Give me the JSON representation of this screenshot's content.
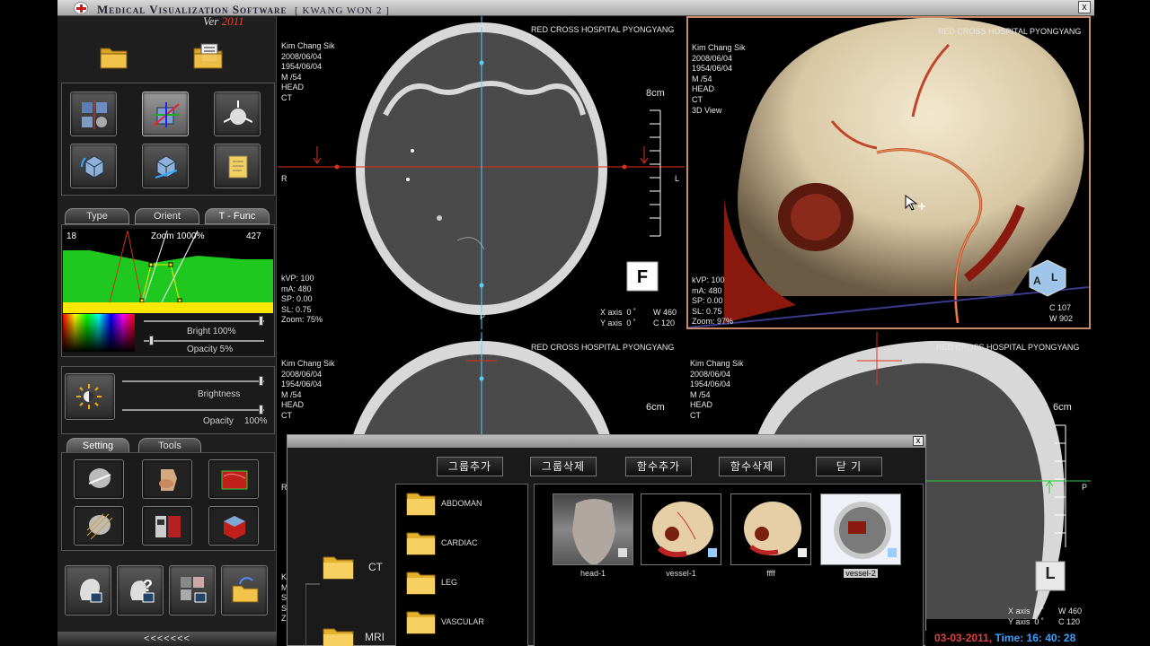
{
  "app": {
    "title": "Medical Visualization Software",
    "version_prefix": "Ver",
    "version_year": "2011",
    "window_name": "[ KWANG WON 2 ]",
    "close_label": "x"
  },
  "left_panel": {
    "tabs_top": [
      "Type",
      "Orient",
      "T - Func"
    ],
    "tf": {
      "min_value": "18",
      "zoom_label": "Zoom 1000%",
      "max_value": "427",
      "bright_label": "Bright  100%",
      "opacity_label": "Opacity     5%",
      "bright_level": 1.0,
      "opacity_level": 0.05
    },
    "brightness": {
      "label": "Brightness",
      "opacity_label": "Opacity",
      "opacity_value": "100%",
      "brightness_level": 1.0,
      "opacity_level": 1.0
    },
    "tabs_bottom": [
      "Setting",
      "Tools"
    ],
    "footer_label": "<<<<<<<"
  },
  "viewports": {
    "axial_top": {
      "hospital": "RED CROSS HOSPITAL PYONGYANG",
      "patient_info": "Kim Chang Sik\n2008/06/04\n1954/06/04\nM /54\nHEAD\nCT",
      "acq_info": "kVP: 100\nmA: 480\nSP: 0.00\nSL: 0.75\nZoom: 75%",
      "scale_label": "8cm",
      "orient_top": "A",
      "orient_left": "R",
      "orient_right": "L",
      "orient_bottom": "P",
      "xy_info": "X axis  0 ˚\nY axis  0 ˚",
      "wl_info": "W 460\nC 120",
      "cube_label": "F"
    },
    "volume_3d": {
      "hospital": "RED CROSS HOSPITAL PYONGYANG",
      "patient_info": "Kim Chang Sik\n2008/06/04\n1954/06/04\nM /54\nHEAD\nCT\n3D View",
      "acq_info": "kVP: 100\nmA: 480\nSP: 0.00\nSL: 0.75\nZoom: 97%",
      "wl_info": "C 107\nW 902",
      "cube_label_a": "A",
      "cube_label_l": "L"
    },
    "axial_bottom": {
      "hospital": "RED CROSS HOSPITAL PYONGYANG",
      "patient_info": "Kim Chang Sik\n2008/06/04\n1954/06/04\nM /54\nHEAD\nCT",
      "scale_label": "6cm",
      "orient_top": "I",
      "orient_left": "R",
      "partial_info": "K\nM\nS\nS\nZ"
    },
    "sagittal": {
      "hospital": "RED CROSS HOSPITAL PYONGYANG",
      "patient_info": "Kim Chang Sik\n2008/06/04\n1954/06/04\nM /54\nHEAD\nCT",
      "scale_label": "6cm",
      "orient_right": "P",
      "xy_info": "X axis  0 ˚\nY axis  0 ˚",
      "wl_info": "W 460\nC 120",
      "cube_label": "L"
    }
  },
  "dialog": {
    "close_label": "x",
    "buttons": [
      "그룹추가",
      "그룹삭제",
      "함수추가",
      "함수삭제",
      "닫 기"
    ],
    "tree_root": [
      "CT",
      "MRI"
    ],
    "tree_items": [
      "ABDOMAN",
      "CARDIAC",
      "LEG",
      "VASCULAR"
    ],
    "thumbnails": [
      "head-1",
      "vessel-1",
      "ffff",
      "vessel-2"
    ],
    "selected_thumbnail": "vessel-2"
  },
  "status": {
    "date": "03-03-2011,",
    "time_label": "Time:",
    "time": "16: 40: 28"
  },
  "colors": {
    "crosshair_red": "#e0301c",
    "crosshair_cyan": "#4fd3ff",
    "crosshair_green": "#2ecc40",
    "tf_green": "#1ec81e",
    "tf_yellow": "#ffe800",
    "status_blue": "#3aa0ff"
  }
}
